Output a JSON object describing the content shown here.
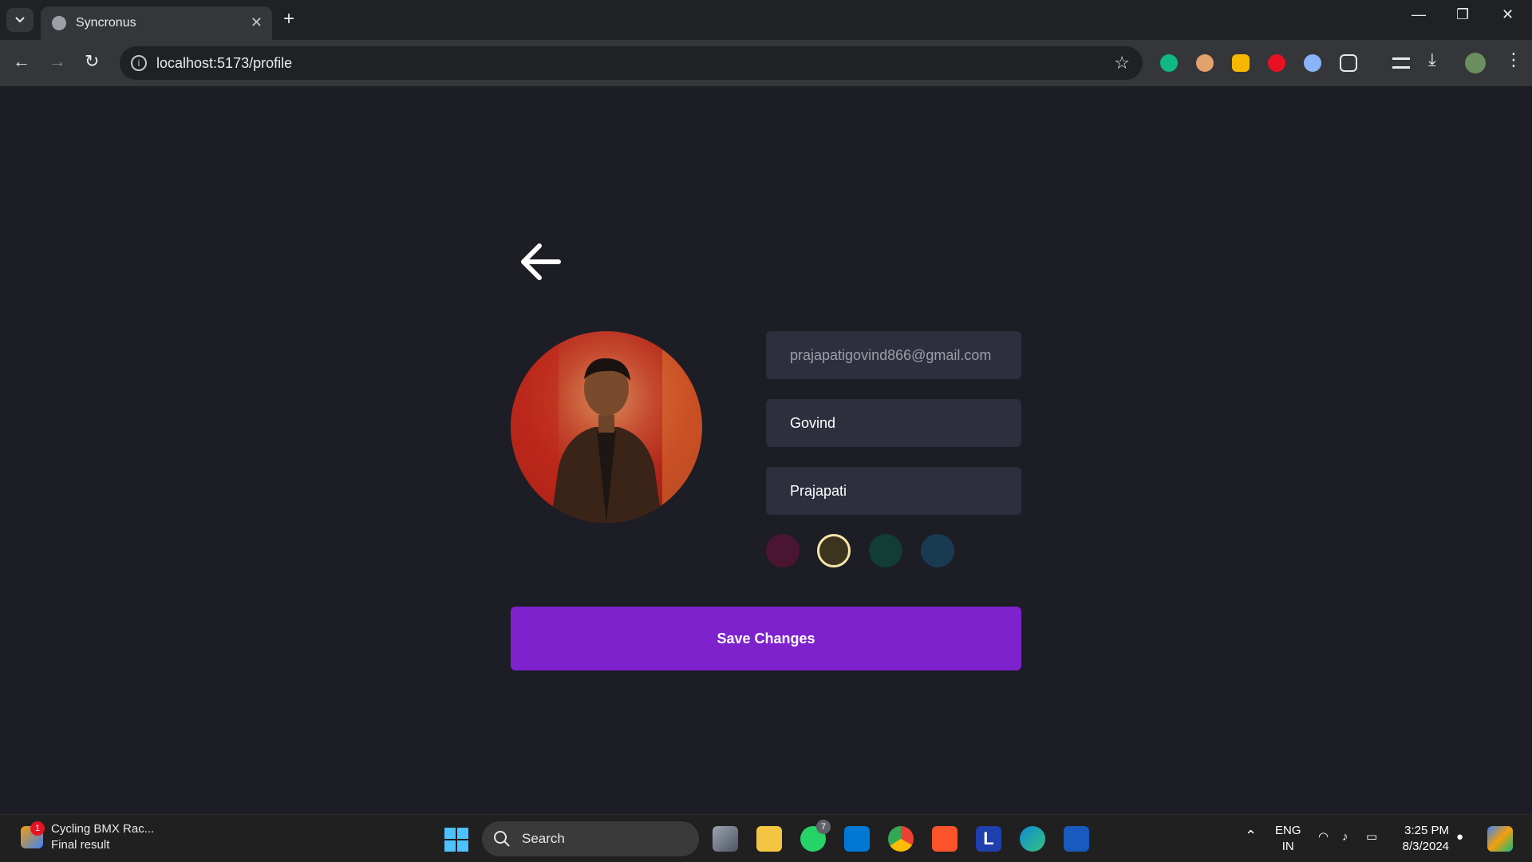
{
  "browser": {
    "tab_title": "Syncronus",
    "url": "localhost:5173/profile",
    "new_tab": "+",
    "tab_close": "✕"
  },
  "profile": {
    "email": "prajapatigovind866@gmail.com",
    "first_name": "Govind",
    "last_name": "Prajapati",
    "colors": [
      "#4a1531",
      "#3d3420",
      "#113d34",
      "#1a3a52"
    ],
    "selected_color_index": 1,
    "save_label": "Save Changes",
    "accent": "#7e22ce"
  },
  "taskbar": {
    "widget_badge": "1",
    "widget_title": "Cycling BMX Rac...",
    "widget_subtitle": "Final result",
    "search_label": "Search",
    "whatsapp_badge": "7",
    "lang_top": "ENG",
    "lang_bottom": "IN",
    "time": "3:25 PM",
    "date": "8/3/2024"
  }
}
